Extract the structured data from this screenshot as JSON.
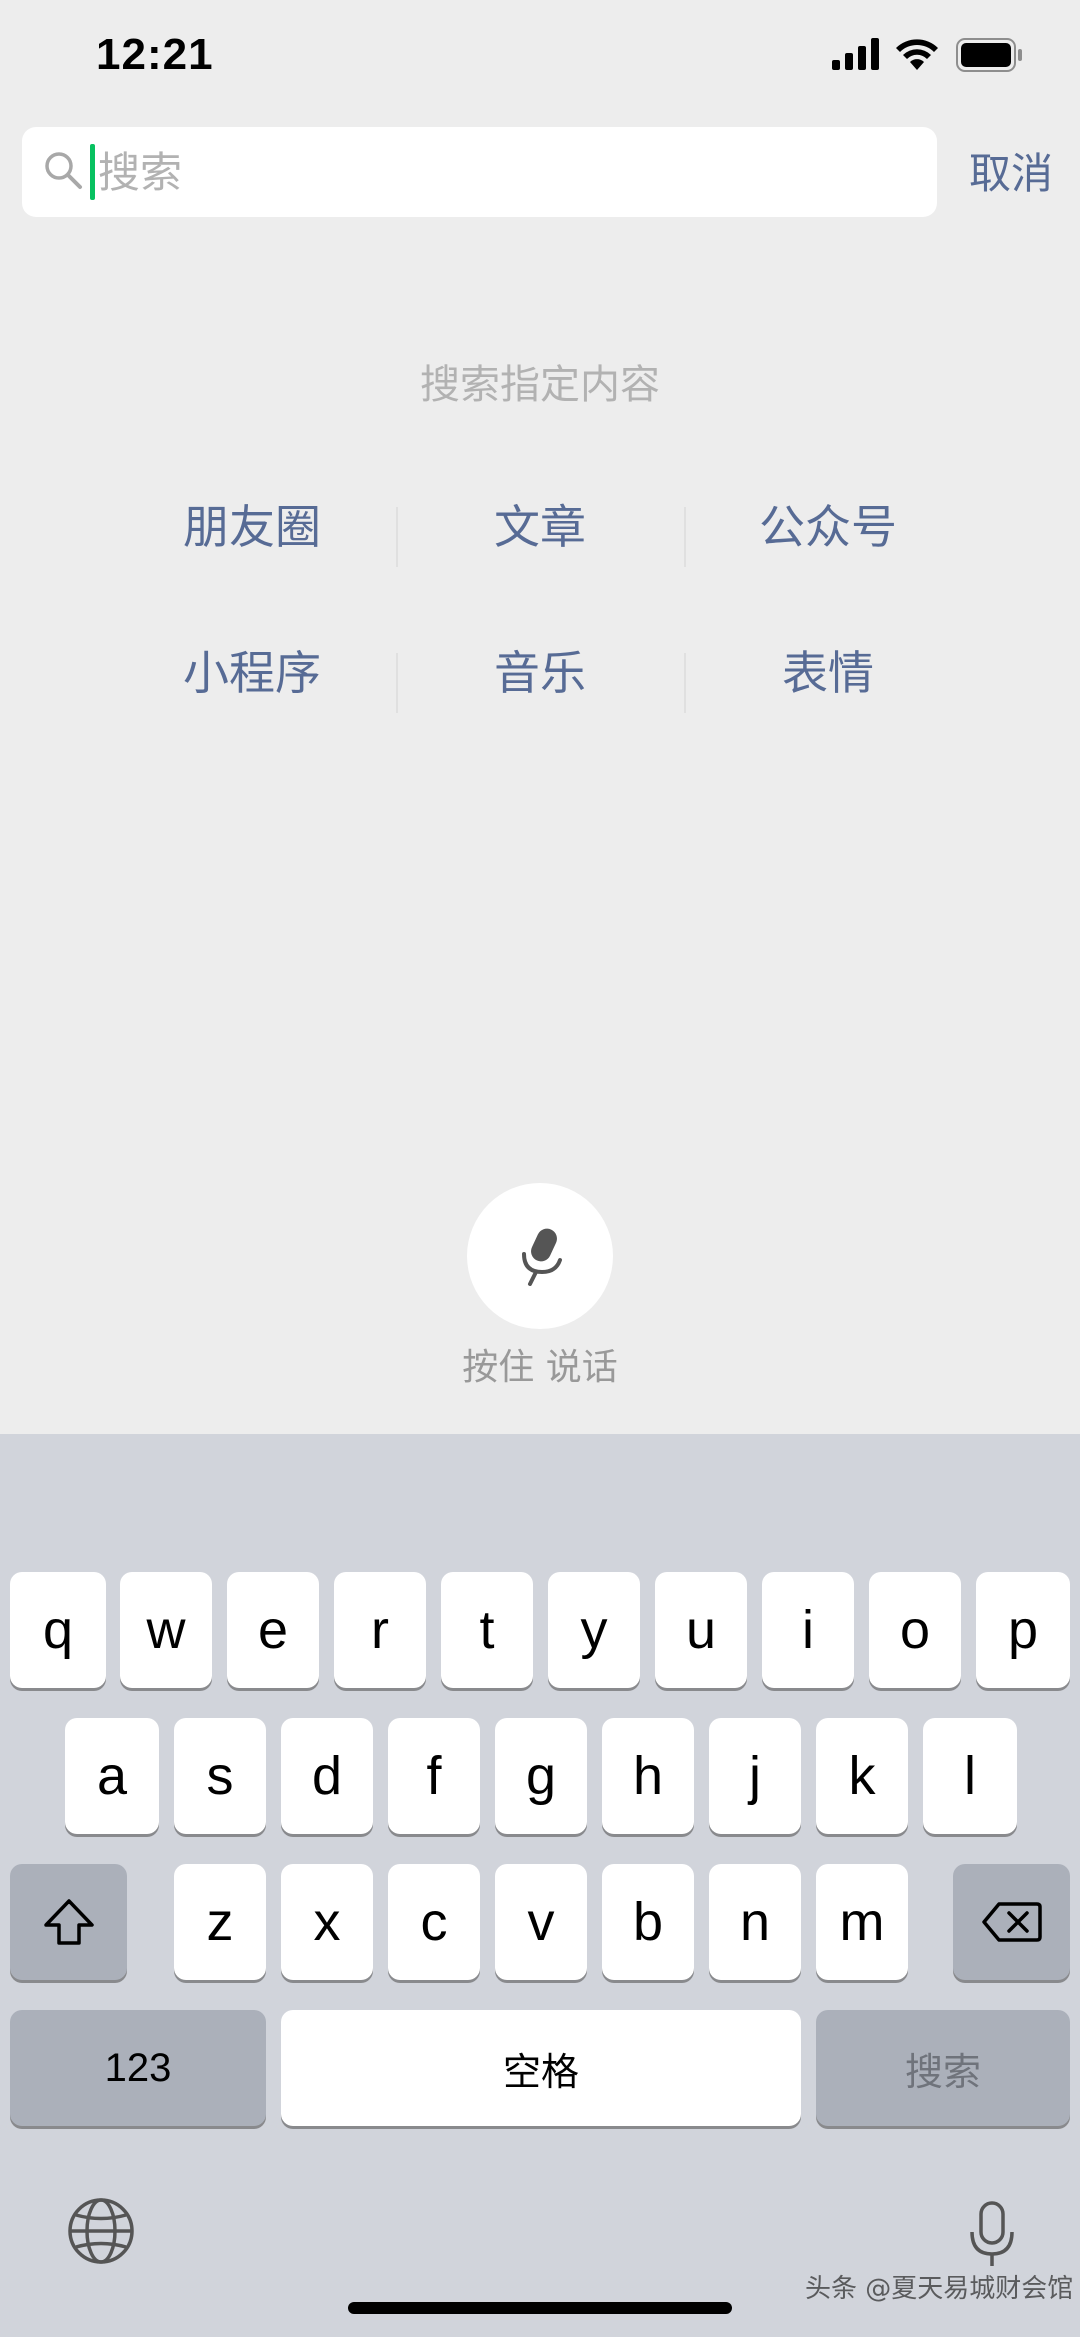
{
  "status_bar": {
    "time": "12:21"
  },
  "search": {
    "placeholder": "搜索",
    "value": "",
    "cancel_label": "取消"
  },
  "hint": "搜索指定内容",
  "categories": [
    [
      "朋友圈",
      "文章",
      "公众号"
    ],
    [
      "小程序",
      "音乐",
      "表情"
    ]
  ],
  "voice": {
    "label": "按住 说话"
  },
  "keyboard": {
    "row1": [
      "q",
      "w",
      "e",
      "r",
      "t",
      "y",
      "u",
      "i",
      "o",
      "p"
    ],
    "row2": [
      "a",
      "s",
      "d",
      "f",
      "g",
      "h",
      "j",
      "k",
      "l"
    ],
    "row3": [
      "z",
      "x",
      "c",
      "v",
      "b",
      "n",
      "m"
    ],
    "numbers_label": "123",
    "space_label": "空格",
    "search_label": "搜索"
  },
  "watermark": "头条 @夏天易城财会馆",
  "colors": {
    "accent": "#576b95",
    "caret": "#07c160",
    "background": "#ededed",
    "keyboard": "#d1d4db"
  }
}
